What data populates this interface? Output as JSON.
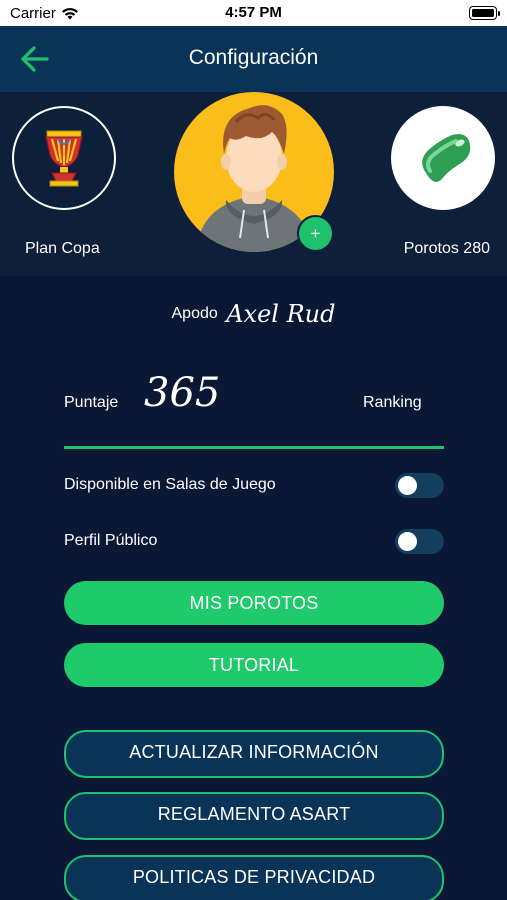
{
  "status": {
    "carrier": "Carrier",
    "time": "4:57 PM"
  },
  "header": {
    "title": "Configuración"
  },
  "profile": {
    "plan_label": "Plan Copa",
    "beans_label": "Porotos 280",
    "add_label": "+"
  },
  "nickname": {
    "label": "Apodo",
    "value": "Axel Rud"
  },
  "score": {
    "label": "Puntaje",
    "value": "365",
    "ranking_label": "Ranking"
  },
  "toggles": [
    {
      "label": "Disponible en Salas de Juego",
      "on": false
    },
    {
      "label": "Perfil Público",
      "on": false
    }
  ],
  "buttons": {
    "mis_porotos": "MIS POROTOS",
    "tutorial": "TUTORIAL",
    "actualizar": "ACTUALIZAR INFORMACIÓN",
    "reglamento": "REGLAMENTO ASART",
    "privacidad": "POLITICAS DE PRIVACIDAD"
  },
  "colors": {
    "accent_green": "#1fc16b",
    "header_bg": "#0a3457",
    "page_bg": "#0a1836",
    "avatar_bg": "#fbbd1a"
  }
}
